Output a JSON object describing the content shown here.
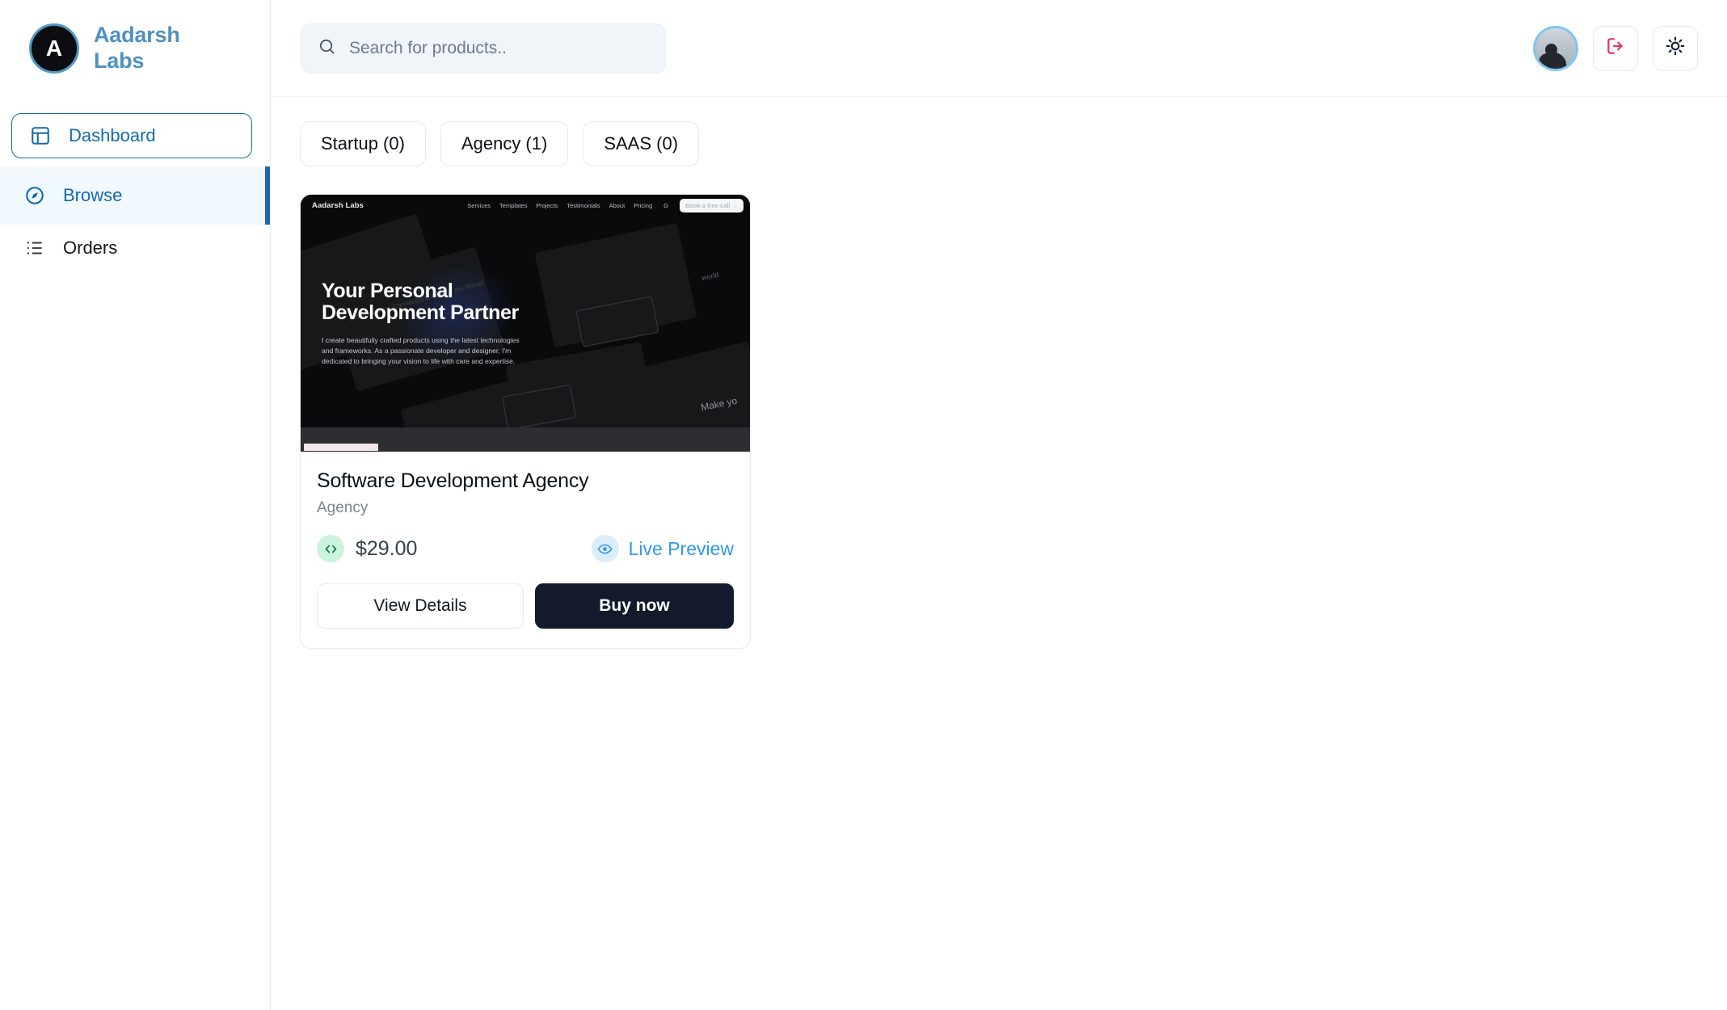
{
  "brand": {
    "initial": "A",
    "name": "Aadarsh Labs"
  },
  "sidebar": {
    "items": [
      {
        "label": "Dashboard",
        "icon": "layout-panel-icon",
        "state": "boxed"
      },
      {
        "label": "Browse",
        "icon": "compass-icon",
        "state": "active"
      },
      {
        "label": "Orders",
        "icon": "list-icon",
        "state": "default"
      }
    ]
  },
  "topbar": {
    "search": {
      "value": "",
      "placeholder": "Search for products.."
    },
    "icons": [
      {
        "name": "avatar",
        "label": "user-avatar"
      },
      {
        "name": "logout-icon",
        "label": "Logout"
      },
      {
        "name": "sun-icon",
        "label": "Toggle theme"
      }
    ]
  },
  "filters": {
    "chips": [
      {
        "label": "Startup (0)",
        "name": "Startup",
        "count": 0
      },
      {
        "label": "Agency (1)",
        "name": "Agency",
        "count": 1
      },
      {
        "label": "SAAS (0)",
        "name": "SAAS",
        "count": 0
      }
    ]
  },
  "product": {
    "title": "Software Development Agency",
    "category": "Agency",
    "price": "$29.00",
    "preview_label": "Live Preview",
    "view_details_label": "View Details",
    "buy_label": "Buy now",
    "thumbnail": {
      "brand": "Aadarsh Labs",
      "nav": [
        "Services",
        "Templates",
        "Projects",
        "Testimonials",
        "About",
        "Pricing"
      ],
      "nav_extra": "G",
      "cta": "Book a free call  →",
      "heading_line1": "Your Personal",
      "heading_line2": "Development Partner",
      "paragraph": "I create beautifully crafted products using the latest technologies and frameworks. As a passionate developer and designer, I'm dedicated to bringing your vision to life with care and expertise.",
      "watermark": "Make yo",
      "watermark2": "world",
      "watermark3": "Discover New Connections Around the World"
    }
  },
  "colors": {
    "brand_blue": "#4f91c0",
    "nav_blue": "#146ba8",
    "active_bg": "#f1f8fe",
    "preview_blue": "#2f9ae8",
    "buy_bg": "#121a2c",
    "code_badge": "#caf4dd",
    "eye_badge": "#daedfb",
    "logout_red": "#f0325a"
  }
}
